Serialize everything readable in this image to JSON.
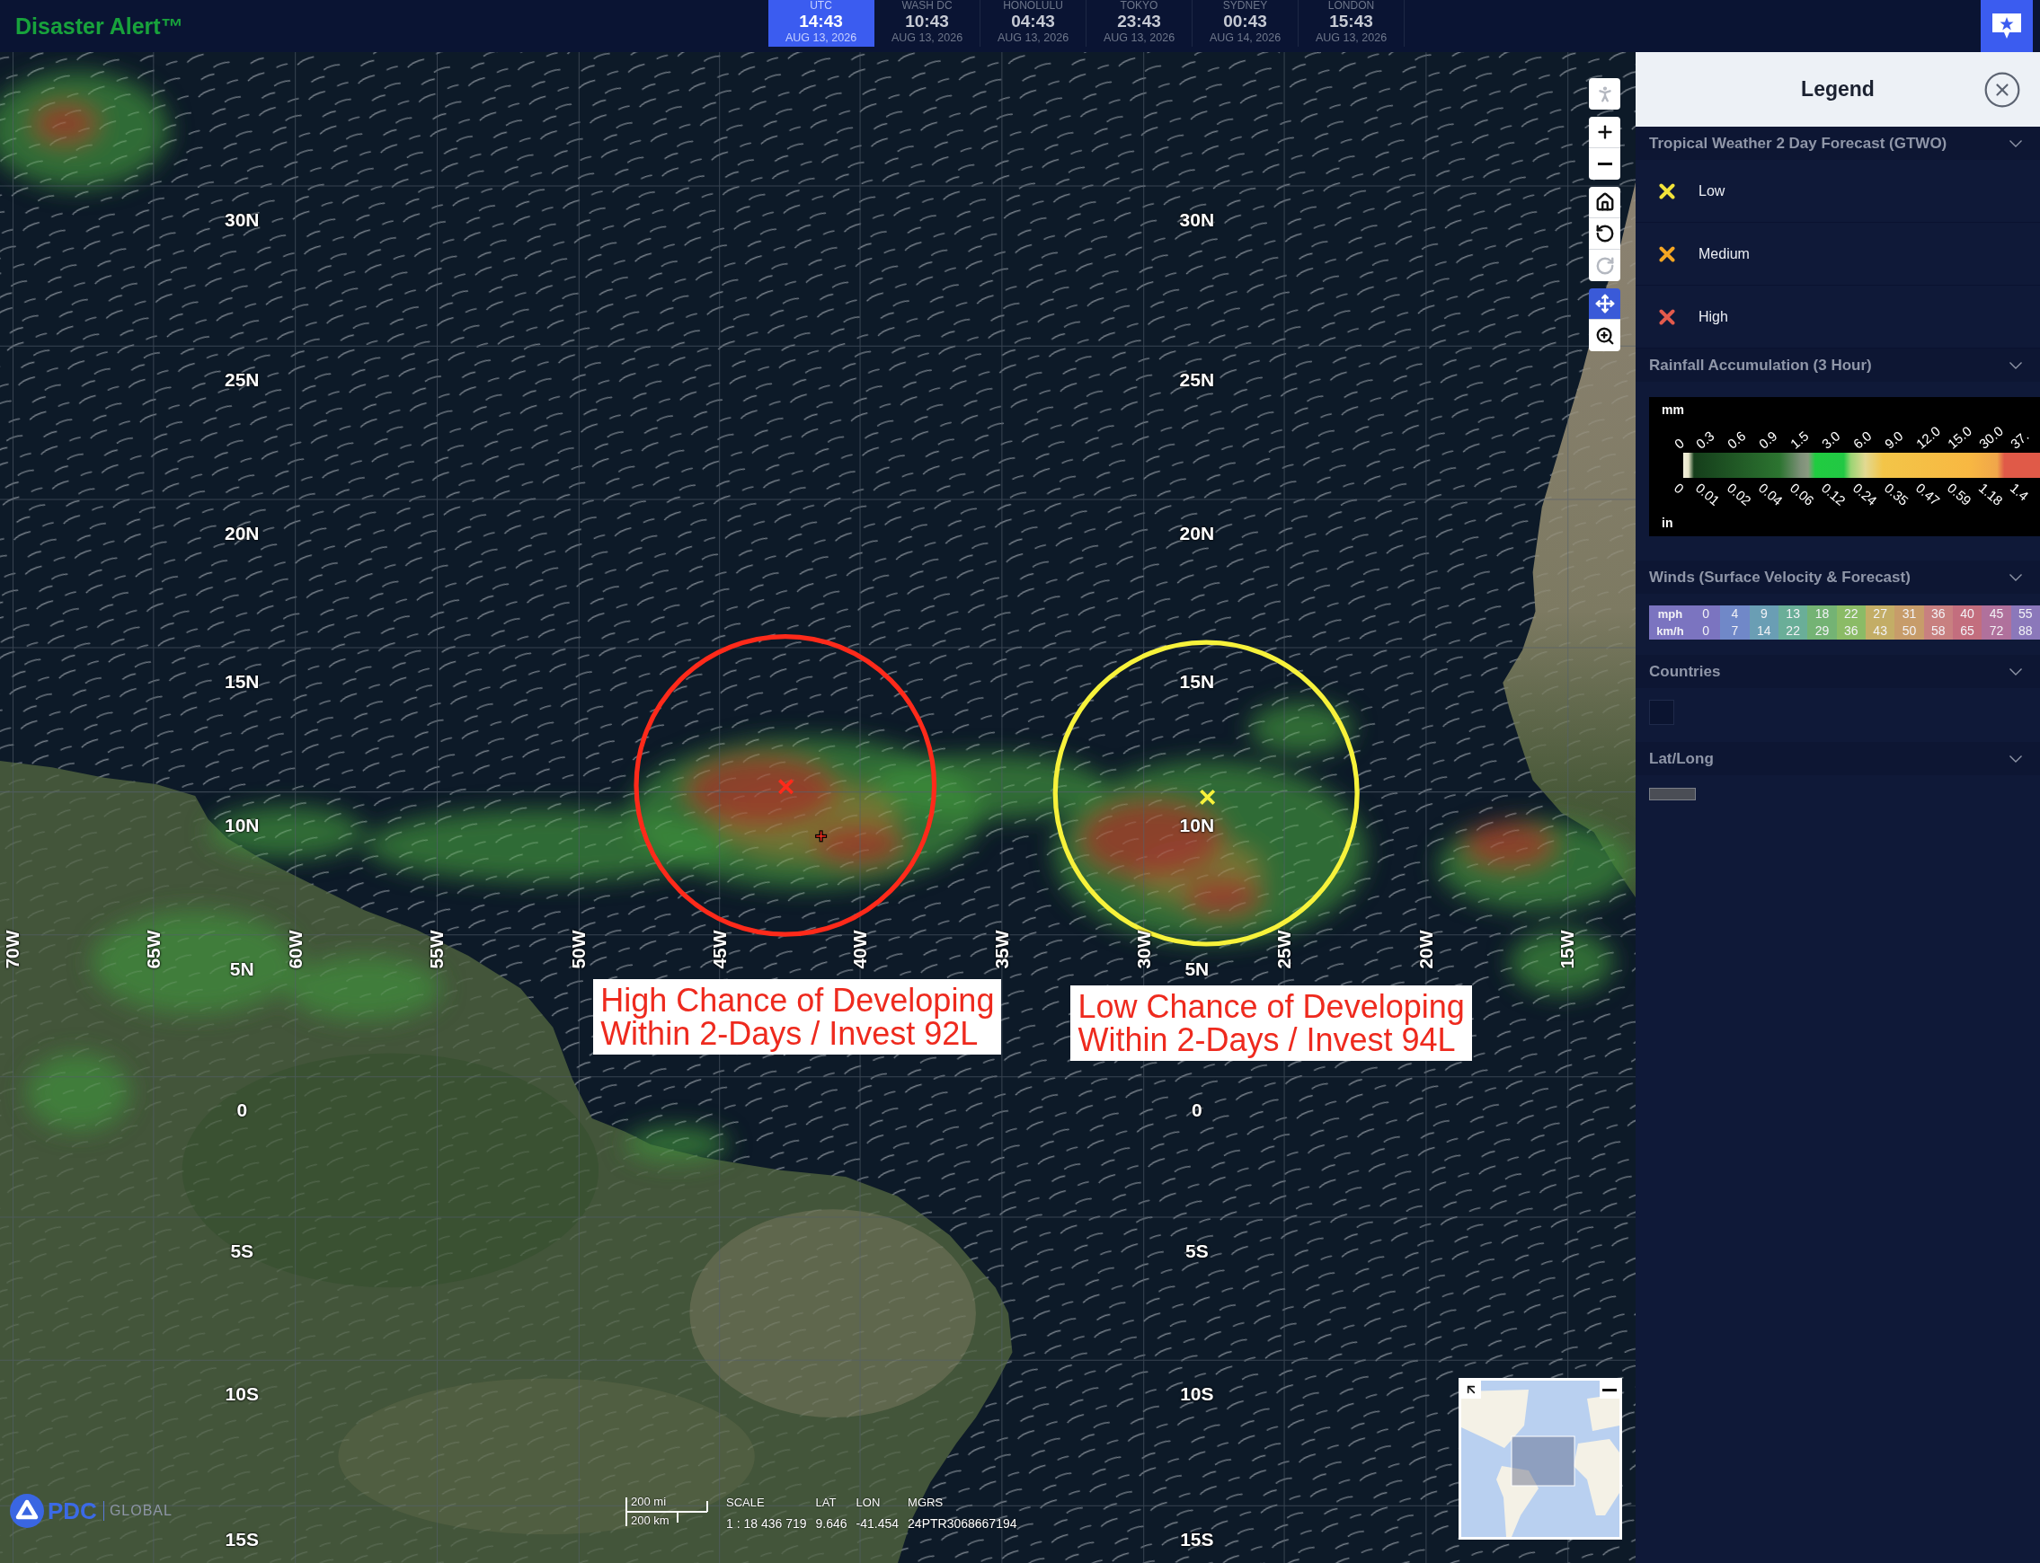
{
  "header": {
    "logo": "Disaster Alert™",
    "clocks": [
      {
        "city": "UTC",
        "time": "14:43",
        "date": "AUG 13, 2026",
        "selected": true
      },
      {
        "city": "WASH DC",
        "time": "10:43",
        "date": "AUG 13, 2026",
        "selected": false
      },
      {
        "city": "HONOLULU",
        "time": "04:43",
        "date": "AUG 13, 2026",
        "selected": false
      },
      {
        "city": "TOKYO",
        "time": "23:43",
        "date": "AUG 13, 2026",
        "selected": false
      },
      {
        "city": "SYDNEY",
        "time": "00:43",
        "date": "AUG 14, 2026",
        "selected": false
      },
      {
        "city": "LONDON",
        "time": "15:43",
        "date": "AUG 13, 2026",
        "selected": false
      }
    ]
  },
  "map": {
    "tool_groups": [
      {
        "tools": [
          {
            "kind": "street-view",
            "selected": false,
            "disabled": true
          }
        ]
      },
      {
        "tools": [
          {
            "kind": "zoom-in",
            "selected": false,
            "disabled": false
          },
          {
            "kind": "zoom-out",
            "selected": false,
            "disabled": false
          }
        ]
      },
      {
        "tools": [
          {
            "kind": "home",
            "selected": false,
            "disabled": false
          },
          {
            "kind": "rotate-left",
            "selected": false,
            "disabled": false
          },
          {
            "kind": "rotate-right",
            "selected": false,
            "disabled": true
          }
        ]
      },
      {
        "tools": [
          {
            "kind": "pan",
            "selected": true,
            "disabled": false
          },
          {
            "kind": "zoom-box",
            "selected": false,
            "disabled": false
          }
        ]
      }
    ],
    "grid": {
      "latitude_columns": [
        {
          "labels": [
            "30N",
            "25N",
            "20N",
            "15N",
            "10N",
            "5N",
            "0",
            "5S",
            "10S",
            "15S"
          ]
        },
        {
          "labels": [
            "30N",
            "25N",
            "20N",
            "15N",
            "10N",
            "5N",
            "0",
            "5S",
            "10S",
            "15S"
          ]
        }
      ],
      "longitude_labels": [
        "70W",
        "65W",
        "60W",
        "55W",
        "50W",
        "45W",
        "40W",
        "35W",
        "30W",
        "25W",
        "20W",
        "15W"
      ]
    },
    "forecast_areas": [
      {
        "color": "#ff2a1a",
        "lines": [
          "High Chance of Developing",
          "Within 2-Days / Invest 92L"
        ]
      },
      {
        "color": "#f7f23b",
        "lines": [
          "Low Chance of Developing",
          "Within 2-Days / Invest 94L"
        ]
      }
    ],
    "logo": {
      "mark": "PDC",
      "tagline": "GLOBAL"
    },
    "scale_bar": {
      "imperial": "200 mi",
      "metric": "200 km"
    },
    "readouts": [
      {
        "label": "SCALE",
        "value": "1 : 18 436 719"
      },
      {
        "label": "LAT",
        "value": "9.646"
      },
      {
        "label": "LON",
        "value": "-41.454"
      },
      {
        "label": "MGRS",
        "value": "24PTR3068667194"
      }
    ]
  },
  "legend": {
    "title": "Legend",
    "sections": [
      {
        "kind": "markers",
        "title": "Tropical Weather 2 Day Forecast (GTWO)",
        "expanded": true,
        "items": [
          {
            "label": "Low",
            "color": "#f2e33a"
          },
          {
            "label": "Medium",
            "color": "#f5a623"
          },
          {
            "label": "High",
            "color": "#e35a4c"
          }
        ]
      },
      {
        "kind": "colorbar",
        "title": "Rainfall Accumulation (3 Hour)",
        "expanded": true,
        "top_unit": "mm",
        "top_labels": [
          "0",
          "0.3",
          "0.6",
          "0.9",
          "1.5",
          "3.0",
          "6.0",
          "9.0",
          "12.0",
          "15.0",
          "30.0",
          "37."
        ],
        "bottom_unit": "in",
        "bottom_labels": [
          "0",
          "0.01",
          "0.02",
          "0.04",
          "0.06",
          "0.12",
          "0.24",
          "0.35",
          "0.47",
          "0.59",
          "1.18",
          "1.4"
        ]
      },
      {
        "kind": "wind-table",
        "title": "Winds (Surface Velocity & Forecast)",
        "expanded": true,
        "units": [
          "mph",
          "km/h"
        ],
        "columns": [
          {
            "values": [
              "0",
              "0"
            ],
            "color": "#7b74c0"
          },
          {
            "values": [
              "4",
              "7"
            ],
            "color": "#7088c8"
          },
          {
            "values": [
              "9",
              "14"
            ],
            "color": "#6a9eb4"
          },
          {
            "values": [
              "13",
              "22"
            ],
            "color": "#6aae98"
          },
          {
            "values": [
              "18",
              "29"
            ],
            "color": "#74b374"
          },
          {
            "values": [
              "22",
              "36"
            ],
            "color": "#8bbb66"
          },
          {
            "values": [
              "27",
              "43"
            ],
            "color": "#c3ad66"
          },
          {
            "values": [
              "31",
              "50"
            ],
            "color": "#c79c6a"
          },
          {
            "values": [
              "36",
              "58"
            ],
            "color": "#c88080"
          },
          {
            "values": [
              "40",
              "65"
            ],
            "color": "#c36e7e"
          },
          {
            "values": [
              "45",
              "72"
            ],
            "color": "#b0719c"
          },
          {
            "values": [
              "55",
              "88"
            ],
            "color": "#8b78ba"
          }
        ]
      },
      {
        "kind": "fill-swatch",
        "title": "Countries",
        "expanded": true
      },
      {
        "kind": "line-swatch",
        "title": "Lat/Long",
        "expanded": true
      }
    ]
  }
}
